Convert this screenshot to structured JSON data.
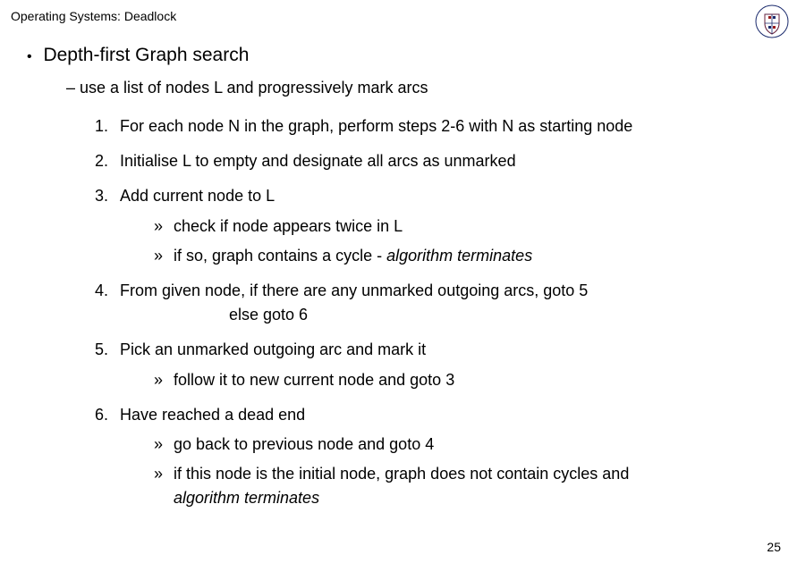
{
  "header": {
    "title": "Operating Systems: Deadlock"
  },
  "crest": {
    "alt": "university-crest"
  },
  "bullet1": {
    "text": "Depth-first Graph search"
  },
  "dash1": {
    "text": "– use a list of nodes L and progressively mark arcs"
  },
  "items": {
    "n1": {
      "num": "1.",
      "text": "For each node N in the graph, perform steps 2-6 with N as starting node"
    },
    "n2": {
      "num": "2.",
      "text": "Initialise L to empty and designate all arcs as unmarked"
    },
    "n3": {
      "num": "3.",
      "text": "Add current node to L",
      "sub1": {
        "text": "check if node appears twice in L"
      },
      "sub2": {
        "prefix": "if so, graph contains a cycle - ",
        "italic": "algorithm terminates"
      }
    },
    "n4": {
      "num": "4.",
      "text": "From given node, if there are any unmarked outgoing arcs, goto 5",
      "cont": "else goto 6"
    },
    "n5": {
      "num": "5.",
      "text": "Pick an unmarked outgoing arc and mark it",
      "sub1": {
        "text": "follow it to new current node and goto 3"
      }
    },
    "n6": {
      "num": "6.",
      "text": "Have reached a dead end",
      "sub1": {
        "text": "go back to previous node and goto 4"
      },
      "sub2": {
        "prefix": "if this node is the initial node, graph does not contain cycles and",
        "italic": "algorithm terminates"
      }
    }
  },
  "footer": {
    "page_number": "25"
  },
  "glyphs": {
    "bullet": "•",
    "raquo": "»"
  }
}
